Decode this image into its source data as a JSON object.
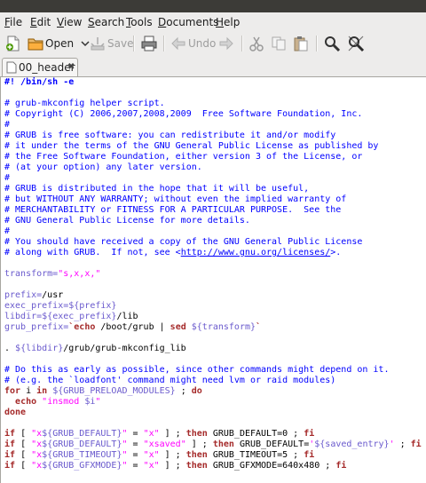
{
  "menu": {
    "file": {
      "u": "F",
      "rest": "ile"
    },
    "edit": {
      "u": "E",
      "rest": "dit"
    },
    "view": {
      "u": "V",
      "rest": "iew"
    },
    "search": {
      "u": "S",
      "rest": "earch"
    },
    "tools": {
      "u": "T",
      "rest": "ools"
    },
    "documents": {
      "u": "D",
      "rest": "ocuments"
    },
    "help": {
      "u": "H",
      "rest": "elp"
    }
  },
  "toolbar": {
    "new_icon": "new-document-icon",
    "open_label": "Open",
    "save_label": "Save",
    "print_icon": "printer-icon",
    "undo_label": "Undo",
    "redo_icon": "redo-arrow-icon",
    "cut_icon": "scissors-icon",
    "copy_icon": "copy-icon",
    "paste_icon": "paste-icon",
    "find_icon": "magnifier-icon",
    "replace_icon": "find-replace-icon"
  },
  "tab": {
    "label": "00_header",
    "close": "✖"
  },
  "editor": {
    "l1": "#! /bin/sh -e",
    "l2": "# grub-mkconfig helper script.",
    "l3": "# Copyright (C) 2006,2007,2008,2009  Free Software Foundation, Inc.",
    "l4": "#",
    "l5": "# GRUB is free software: you can redistribute it and/or modify",
    "l6": "# it under the terms of the GNU General Public License as published by",
    "l7": "# the Free Software Foundation, either version 3 of the License, or",
    "l8": "# (at your option) any later version.",
    "l9": "#",
    "l10": "# GRUB is distributed in the hope that it will be useful,",
    "l11": "# but WITHOUT ANY WARRANTY; without even the implied warranty of",
    "l12": "# MERCHANTABILITY or FITNESS FOR A PARTICULAR PURPOSE.  See the",
    "l13": "# GNU General Public License for more details.",
    "l14": "#",
    "l15": "# You should have received a copy of the GNU General Public License",
    "l16a": "# along with GRUB.  If not, see <",
    "l16b": "http://www.gnu.org/licenses/",
    "l16c": ">.",
    "l17a": "transform=",
    "l17b": "\"s,x,x,\"",
    "l18a": "prefix=",
    "l18b": "/usr",
    "l19a": "exec_prefix=",
    "l19b": "${prefix}",
    "l20a": "libdir=",
    "l20b": "${exec_prefix}",
    "l20c": "/lib",
    "l21a": "grub_prefix=",
    "l21b": "`",
    "l21c": "echo",
    "l21d": " /boot/grub | ",
    "l21e": "sed",
    "l21f": " ",
    "l21g": "${transform}",
    "l21h": "`",
    "l22a": ". ",
    "l22b": "${libdir}",
    "l22c": "/grub/grub-mkconfig_lib",
    "l23": "# Do this as early as possible, since other commands might depend on it.",
    "l24": "# (e.g. the `loadfont' command might need lvm or raid modules)",
    "l25a": "for",
    "l25b": " i ",
    "l25c": "in",
    "l25d": " ",
    "l25e": "${GRUB_PRELOAD_MODULES}",
    "l25f": " ; ",
    "l25g": "do",
    "l26a": "  ",
    "l26b": "echo",
    "l26c": " ",
    "l26d": "\"insmod ",
    "l26e": "$i",
    "l26f": "\"",
    "l27": "done",
    "if": "if",
    "then": "then",
    "fi": "fi",
    "l28a": " [ ",
    "l28b": "\"x",
    "l28c": "${GRUB_DEFAULT}",
    "l28d": "\"",
    "l28e": " = ",
    "l28f": "\"x\"",
    "l28g": " ] ; ",
    "l28h": " GRUB_DEFAULT=0 ; ",
    "l29f": "\"xsaved\"",
    "l29h": " GRUB_DEFAULT=",
    "l29i": "'",
    "l29j": "${saved_entry}",
    "l29k": "'",
    "l29l": " ; ",
    "l30c": "${GRUB_TIMEOUT}",
    "l30h": " GRUB_TIMEOUT=5 ; ",
    "l31c": "${GRUB_GFXMODE}",
    "l31h": " GRUB_GFXMODE=640x480 ; "
  }
}
